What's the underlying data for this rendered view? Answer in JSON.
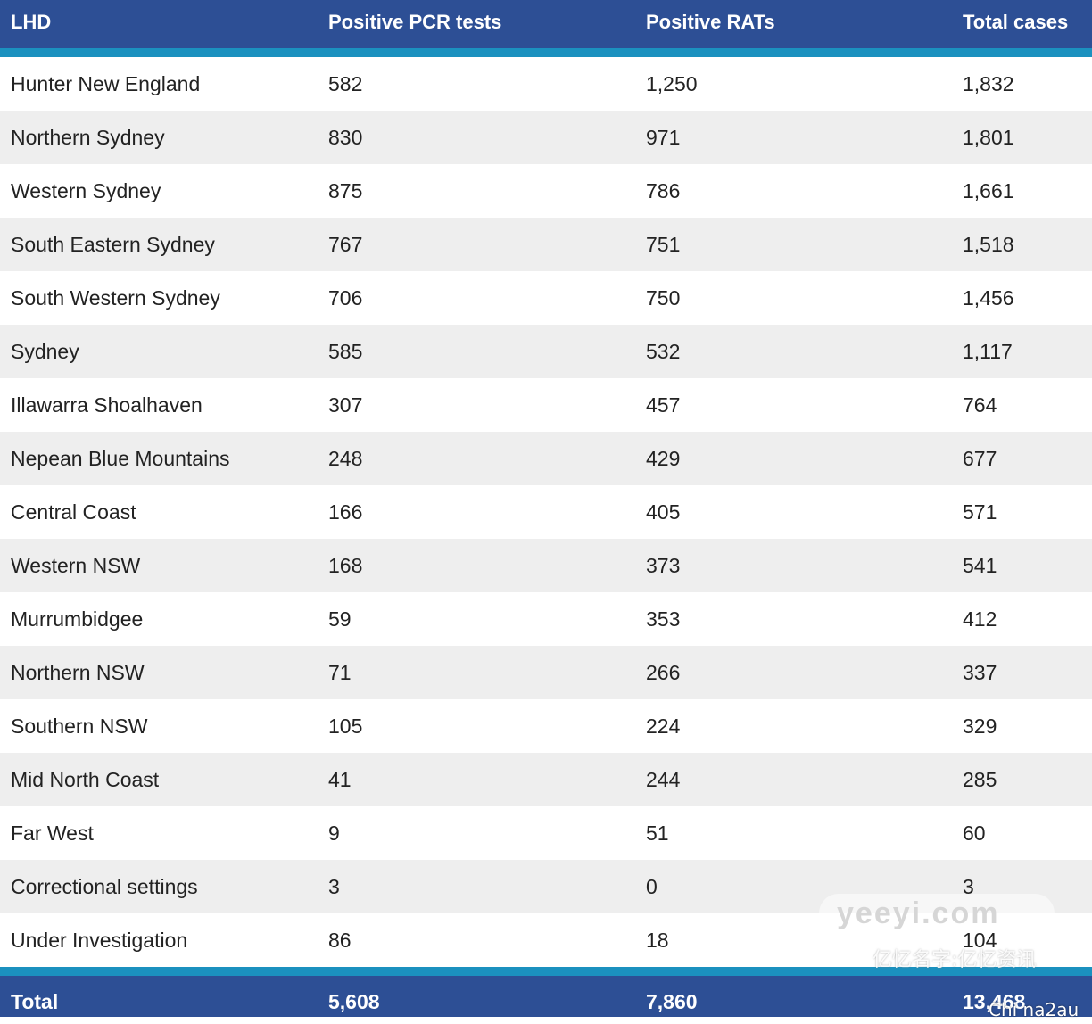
{
  "columns": [
    "LHD",
    "Positive PCR tests",
    "Positive RATs",
    "Total cases"
  ],
  "rows": [
    {
      "lhd": "Hunter New England",
      "pcr": "582",
      "rat": "1,250",
      "total": "1,832"
    },
    {
      "lhd": "Northern Sydney",
      "pcr": "830",
      "rat": "971",
      "total": "1,801"
    },
    {
      "lhd": "Western Sydney",
      "pcr": "875",
      "rat": "786",
      "total": "1,661"
    },
    {
      "lhd": "South Eastern Sydney",
      "pcr": "767",
      "rat": "751",
      "total": "1,518"
    },
    {
      "lhd": "South Western Sydney",
      "pcr": "706",
      "rat": "750",
      "total": "1,456"
    },
    {
      "lhd": "Sydney",
      "pcr": "585",
      "rat": "532",
      "total": "1,117"
    },
    {
      "lhd": "Illawarra Shoalhaven",
      "pcr": "307",
      "rat": "457",
      "total": "764"
    },
    {
      "lhd": "Nepean Blue Mountains",
      "pcr": "248",
      "rat": "429",
      "total": "677"
    },
    {
      "lhd": "Central Coast",
      "pcr": "166",
      "rat": "405",
      "total": "571"
    },
    {
      "lhd": "Western NSW",
      "pcr": "168",
      "rat": "373",
      "total": "541"
    },
    {
      "lhd": "Murrumbidgee",
      "pcr": "59",
      "rat": "353",
      "total": "412"
    },
    {
      "lhd": "Northern NSW",
      "pcr": "71",
      "rat": "266",
      "total": "337"
    },
    {
      "lhd": "Southern NSW",
      "pcr": "105",
      "rat": "224",
      "total": "329"
    },
    {
      "lhd": "Mid North Coast",
      "pcr": "41",
      "rat": "244",
      "total": "285"
    },
    {
      "lhd": "Far West",
      "pcr": "9",
      "rat": "51",
      "total": "60"
    },
    {
      "lhd": "Correctional settings",
      "pcr": "3",
      "rat": "0",
      "total": "3"
    },
    {
      "lhd": "Under Investigation",
      "pcr": "86",
      "rat": "18",
      "total": "104"
    }
  ],
  "total": {
    "lhd": "Total",
    "pcr": "5,608",
    "rat": "7,860",
    "total": "13,468"
  },
  "watermark": {
    "logo": "yeeyi.com",
    "text": "亿忆名字:亿忆资讯",
    "corner": "Chi na2au"
  },
  "colors": {
    "header_bg": "#2d4f95",
    "accent_rule": "#1b91bf",
    "alt_row_bg": "#eeeeee"
  }
}
